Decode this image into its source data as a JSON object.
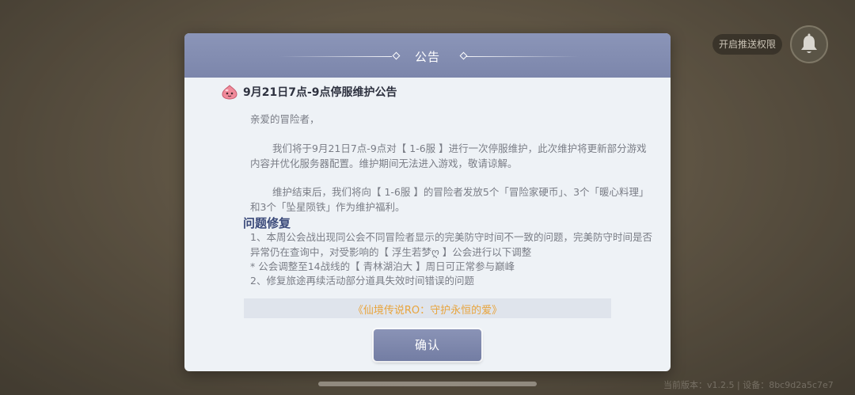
{
  "push_permission_label": "开启推送权限",
  "status_text": "当前版本：v1.2.5 | 设备：8bc9d2a5c7e7",
  "dialog": {
    "title": "公告",
    "notice_title": "9月21日7点-9点停服维护公告",
    "greeting": "亲爱的冒险者，",
    "para1": "我们将于9月21日7点-9点对【 1-6服 】进行一次停服维护，此次维护将更新部分游戏内容并优化服务器配置。维护期间无法进入游戏，敬请谅解。",
    "para2": "维护结束后，我们将向【 1-6服 】的冒险者发放5个「冒险家硬币」、3个「暖心料理」和3个「坠星陨铁」作为维护福利。",
    "section_title": "问题修复",
    "fix1": "1、本周公会战出现同公会不同冒险者显示的完美防守时间不一致的问题，完美防守时间是否异常仍在查询中，对受影响的【 浮生若梦ღ 】公会进行以下调整",
    "fix1_note": "* 公会调整至14战线的【 青林湖泊大 】周日可正常参与巅峰",
    "fix2": "2、修复旅途再续活动部分道具失效时间错误的问题",
    "slogan": "《仙境传说RO：守护永恒的爱》",
    "confirm_label": "确认"
  },
  "icons": {
    "bell": "bell-icon",
    "poring": "poring-icon"
  },
  "colors": {
    "header": "#7c86ab",
    "slogan": "#e8a43c",
    "section_title": "#3b4a7a"
  }
}
